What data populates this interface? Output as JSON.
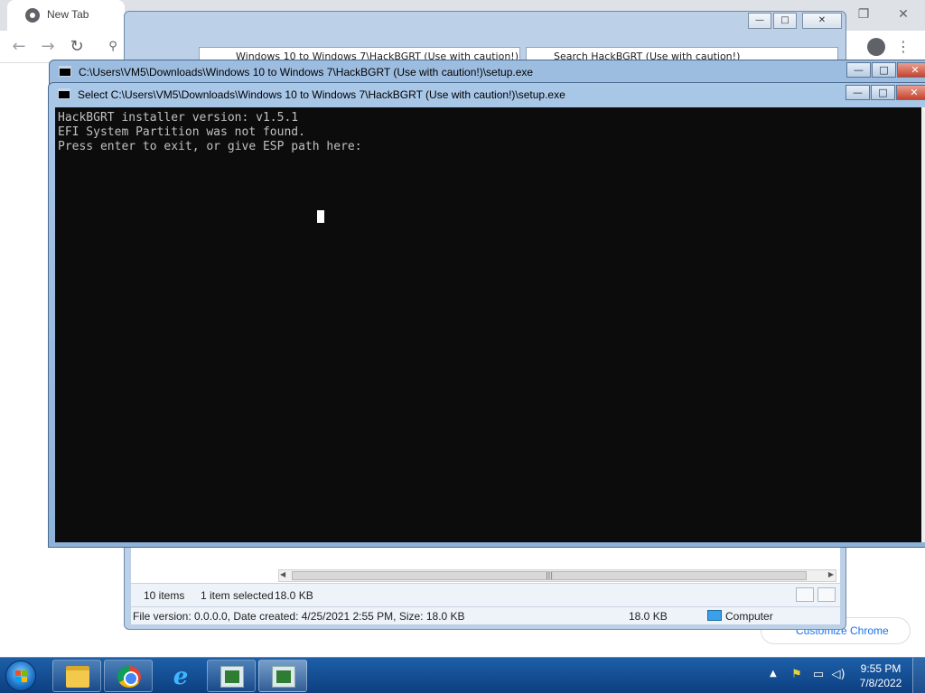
{
  "chrome": {
    "tab_title": "New Tab",
    "customize_label": "Customize Chrome",
    "icons": [
      "chrome-favicon",
      "back-arrow",
      "forward-arrow",
      "reload",
      "search",
      "profile-avatar",
      "kebab-menu"
    ]
  },
  "explorer": {
    "address_text": "Windows 10 to Windows 7\\HackBGRT (Use with caution!)",
    "search_text": "Search HackBGRT (Use with caution!)",
    "items_count": "10 items",
    "selected": "1 item selected",
    "selected_size": "18.0 KB",
    "details": "File version: 0.0.0.0, Date created: 4/25/2021 2:55 PM, Size: 18.0 KB",
    "details_size": "18.0 KB",
    "location": "Computer"
  },
  "console_back": {
    "title": "C:\\Users\\VM5\\Downloads\\Windows 10 to Windows 7\\HackBGRT (Use with caution!)\\setup.exe"
  },
  "console_front": {
    "title": "Select C:\\Users\\VM5\\Downloads\\Windows 10 to Windows 7\\HackBGRT (Use with caution!)\\setup.exe",
    "lines": [
      "HackBGRT installer version: v1.5.1",
      "EFI System Partition was not found.",
      "Press enter to exit, or give ESP path here:"
    ]
  },
  "taskbar": {
    "apps": [
      "windows-explorer",
      "google-chrome",
      "internet-explorer",
      "console-setup-1",
      "console-setup-2"
    ],
    "clock_time": "9:55 PM",
    "clock_date": "7/8/2022"
  },
  "colors": {
    "console_bg": "#0c0c0c",
    "console_text": "#c0c0c0",
    "taskbar": "#1d5fa8",
    "chrome_link": "#1a73e8"
  }
}
